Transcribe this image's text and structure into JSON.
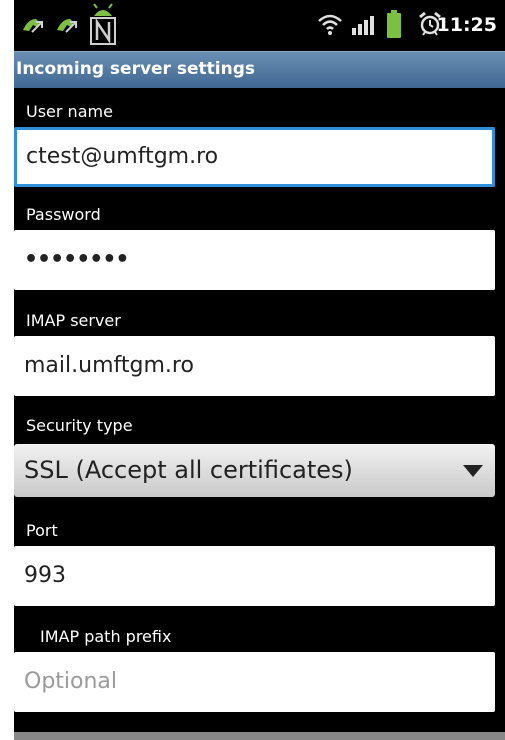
{
  "status_bar": {
    "time": "11:25",
    "icons": [
      "missed-call-icon",
      "missed-call-icon",
      "android-notification-icon",
      "wifi-icon",
      "signal-icon",
      "battery-icon",
      "alarm-icon"
    ]
  },
  "title_bar": {
    "title": "Incoming server settings"
  },
  "form": {
    "username": {
      "label": "User name",
      "value": "ctest@umftgm.ro"
    },
    "password": {
      "label": "Password",
      "value": "••••••••"
    },
    "imap_server": {
      "label": "IMAP server",
      "value": "mail.umftgm.ro"
    },
    "security_type": {
      "label": "Security type",
      "value": "SSL (Accept all certificates)"
    },
    "port": {
      "label": "Port",
      "value": "993"
    },
    "imap_path_prefix": {
      "label": "IMAP path prefix",
      "placeholder": "Optional"
    }
  },
  "colors": {
    "title_bar": "#4f77a1",
    "focus_border": "#2f8fd8",
    "background": "#000000"
  }
}
